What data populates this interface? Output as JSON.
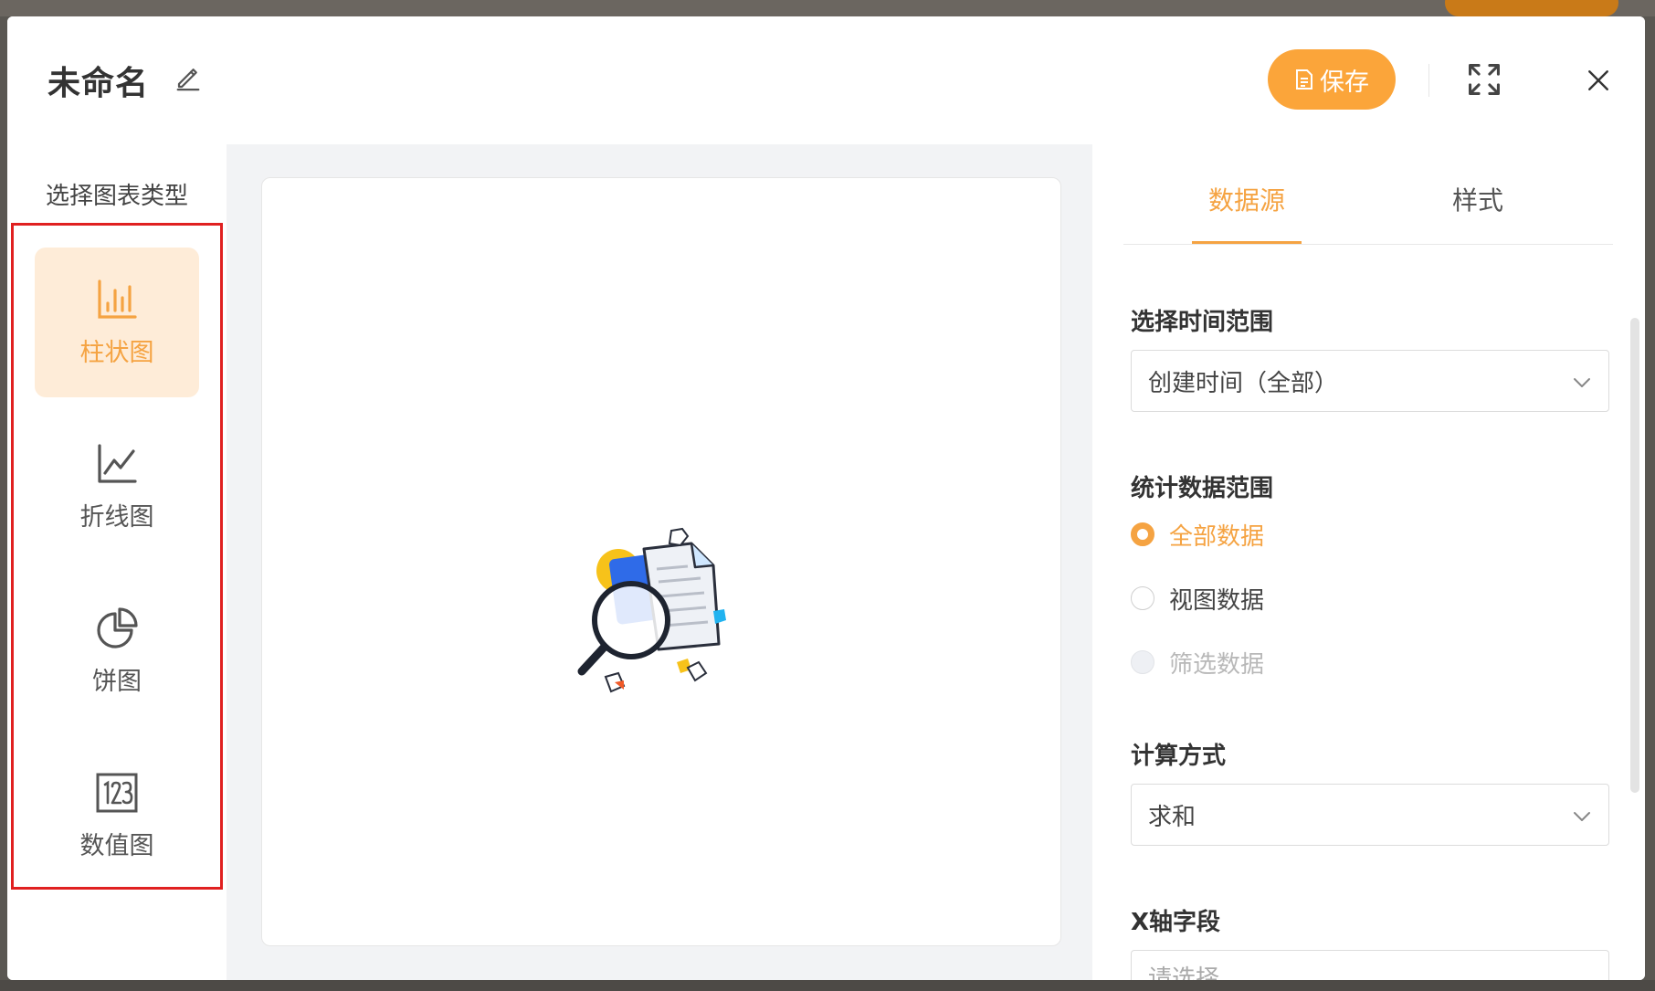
{
  "modal": {
    "title": "未命名",
    "save_label": "保存",
    "colors": {
      "accent": "#fba53a",
      "active_text": "#f5a342",
      "active_bg": "#feecd8",
      "highlight_border": "#e02020"
    }
  },
  "sidebar": {
    "title": "选择图表类型",
    "items": [
      {
        "label": "柱状图",
        "icon": "bar-chart-icon",
        "active": true
      },
      {
        "label": "折线图",
        "icon": "line-chart-icon",
        "active": false
      },
      {
        "label": "饼图",
        "icon": "pie-chart-icon",
        "active": false
      },
      {
        "label": "数值图",
        "icon": "number-chart-icon",
        "active": false
      }
    ]
  },
  "right_panel": {
    "tabs": [
      {
        "label": "数据源",
        "active": true
      },
      {
        "label": "样式",
        "active": false
      }
    ],
    "time_range": {
      "label": "选择时间范围",
      "value": "创建时间（全部）"
    },
    "data_range": {
      "label": "统计数据范围",
      "options": [
        {
          "label": "全部数据",
          "state": "checked"
        },
        {
          "label": "视图数据",
          "state": "unchecked"
        },
        {
          "label": "筛选数据",
          "state": "disabled"
        }
      ]
    },
    "calc_method": {
      "label": "计算方式",
      "value": "求和"
    },
    "x_axis": {
      "label": "X轴字段",
      "placeholder": "请选择"
    }
  }
}
